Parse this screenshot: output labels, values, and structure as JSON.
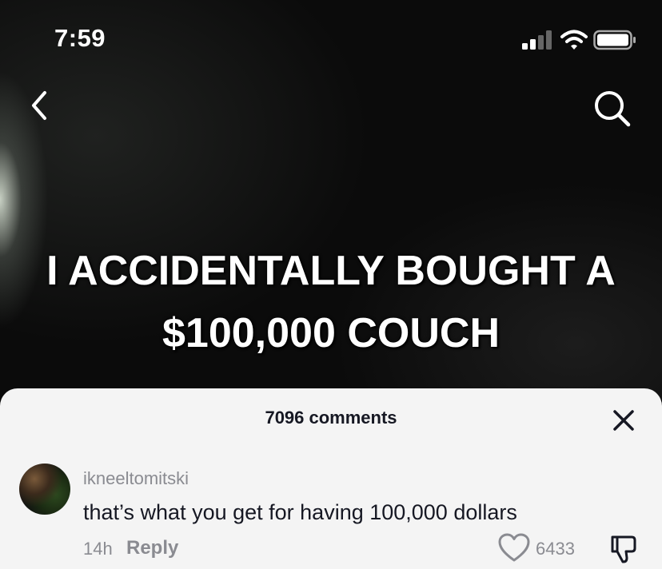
{
  "status_bar": {
    "time": "7:59"
  },
  "video": {
    "caption_line1": "I ACCIDENTALLY BOUGHT A",
    "caption_line2": "$100,000 COUCH"
  },
  "comments_sheet": {
    "count_label": "7096 comments",
    "comments": [
      {
        "username": "ikneeltomitski",
        "text": "that’s what you get for having 100,000 dollars",
        "time": "14h",
        "reply_label": "Reply",
        "likes": "6433"
      }
    ]
  },
  "colors": {
    "sheet_background": "#f4f4f4",
    "primary_text": "#161823",
    "secondary_text": "#8a8b91"
  },
  "icons": [
    "signal-icon",
    "wifi-icon",
    "battery-icon",
    "back-arrow-icon",
    "search-icon",
    "close-icon",
    "heart-icon",
    "thumbs-down-icon"
  ]
}
